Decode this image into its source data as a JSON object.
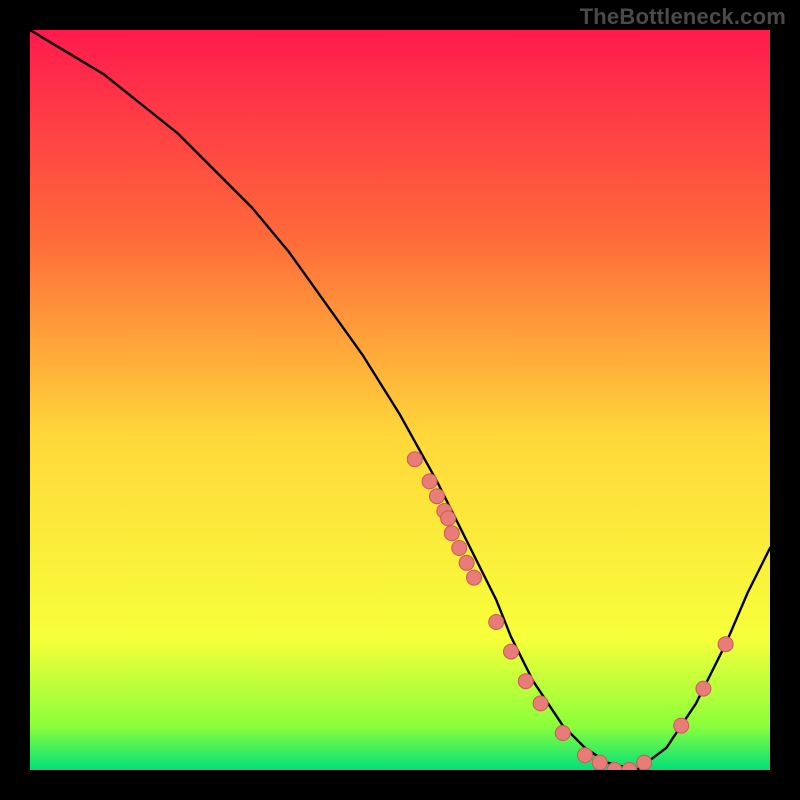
{
  "watermark": "TheBottleneck.com",
  "colors": {
    "background": "#000000",
    "gradient_top": "#ff1a4d",
    "gradient_upper_mid": "#ff6a3a",
    "gradient_mid": "#ffd83a",
    "gradient_lower_mid": "#f7ff3a",
    "gradient_bottom_band": "#8cff3a",
    "gradient_bottom_edge": "#00e07a",
    "curve": "#000000",
    "dot_fill": "#e77c78",
    "dot_stroke": "#cc5a56"
  },
  "chart_data": {
    "type": "line",
    "title": "",
    "xlabel": "",
    "ylabel": "",
    "xlim": [
      0,
      100
    ],
    "ylim": [
      0,
      100
    ],
    "series": [
      {
        "name": "bottleneck-curve",
        "x": [
          0,
          5,
          10,
          15,
          20,
          25,
          30,
          35,
          40,
          45,
          50,
          55,
          60,
          63,
          65,
          68,
          72,
          75,
          78,
          82,
          86,
          90,
          94,
          97,
          100
        ],
        "y": [
          100,
          97,
          94,
          90,
          86,
          81,
          76,
          70,
          63,
          56,
          48,
          39,
          29,
          23,
          18,
          12,
          6,
          3,
          1,
          0,
          3,
          9,
          17,
          24,
          30
        ]
      },
      {
        "name": "marker-dots",
        "x": [
          52,
          54,
          55,
          56,
          56.5,
          57,
          58,
          59,
          60,
          63,
          65,
          67,
          69,
          72,
          75,
          77,
          79,
          81,
          83,
          88,
          91,
          94
        ],
        "y": [
          42,
          39,
          37,
          35,
          34,
          32,
          30,
          28,
          26,
          20,
          16,
          12,
          9,
          5,
          2,
          1,
          0,
          0,
          1,
          6,
          11,
          17
        ]
      }
    ]
  }
}
